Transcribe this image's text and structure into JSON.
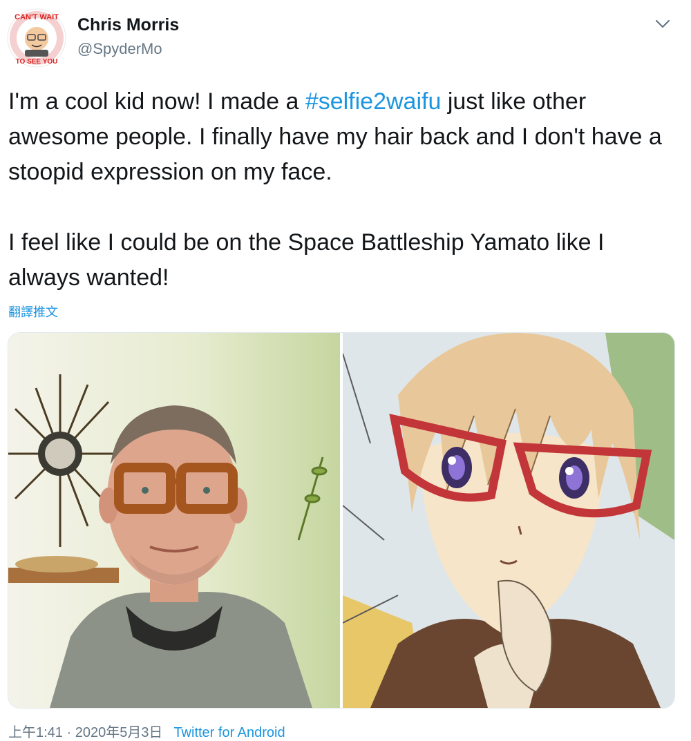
{
  "tweet": {
    "author_name": "Chris Morris",
    "author_handle": "@SpyderMo",
    "avatar_badge_text": "CAN'T WAIT TO SEE YOU",
    "text_before_hashtag": "I'm a cool kid now! I made a ",
    "hashtag": "#selfie2waifu",
    "text_after_hashtag": " just like other awesome people. I finally have my hair back and I don't have a stoopid expression on my face.",
    "paragraph_2": "I feel like I could be on the Space Battleship Yamato like I always wanted!",
    "translate_label": "翻譯推文",
    "timestamp": "上午1:41 · 2020年5月3日",
    "source_link": "Twitter for Android"
  },
  "icons": {
    "menu": "chevron-down-icon"
  },
  "media": {
    "photos": [
      {
        "description_name": "selfie-photo"
      },
      {
        "description_name": "anime-portrait-photo"
      }
    ]
  },
  "colors": {
    "link": "#1b95e0",
    "secondary_text": "#657786",
    "primary_text": "#14171a"
  }
}
